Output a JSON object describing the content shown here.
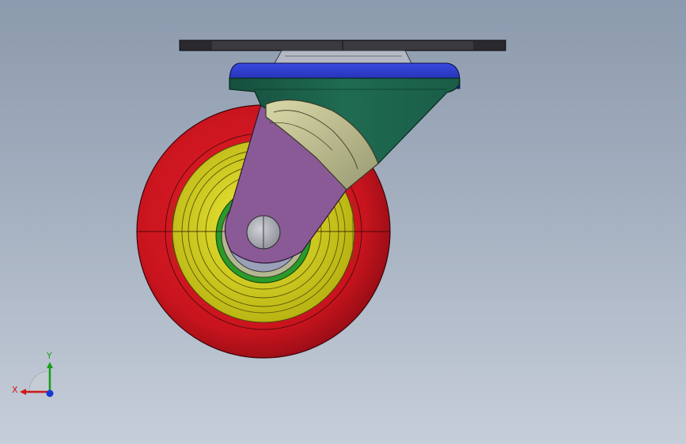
{
  "viewport": {
    "background_top": "#8c9aad",
    "background_bottom": "#c6ced9"
  },
  "model": {
    "parts": [
      {
        "name": "mounting-plate",
        "color": "#2a2a2e"
      },
      {
        "name": "swivel-raceway",
        "color": "#2334c8"
      },
      {
        "name": "yoke",
        "color": "#1f6b52"
      },
      {
        "name": "side-plate",
        "color": "#8a5a96"
      },
      {
        "name": "wheel-tread",
        "color": "#c8141e"
      },
      {
        "name": "wheel-core",
        "color": "#d6d21e"
      },
      {
        "name": "bearing-ring",
        "color": "#2a9a2a"
      },
      {
        "name": "axle-bolt",
        "color": "#a8aab0"
      }
    ]
  },
  "triad": {
    "x_label": "X",
    "y_label": "Y",
    "x_color": "#d01818",
    "y_color": "#18a018",
    "z_color": "#1838d8"
  }
}
